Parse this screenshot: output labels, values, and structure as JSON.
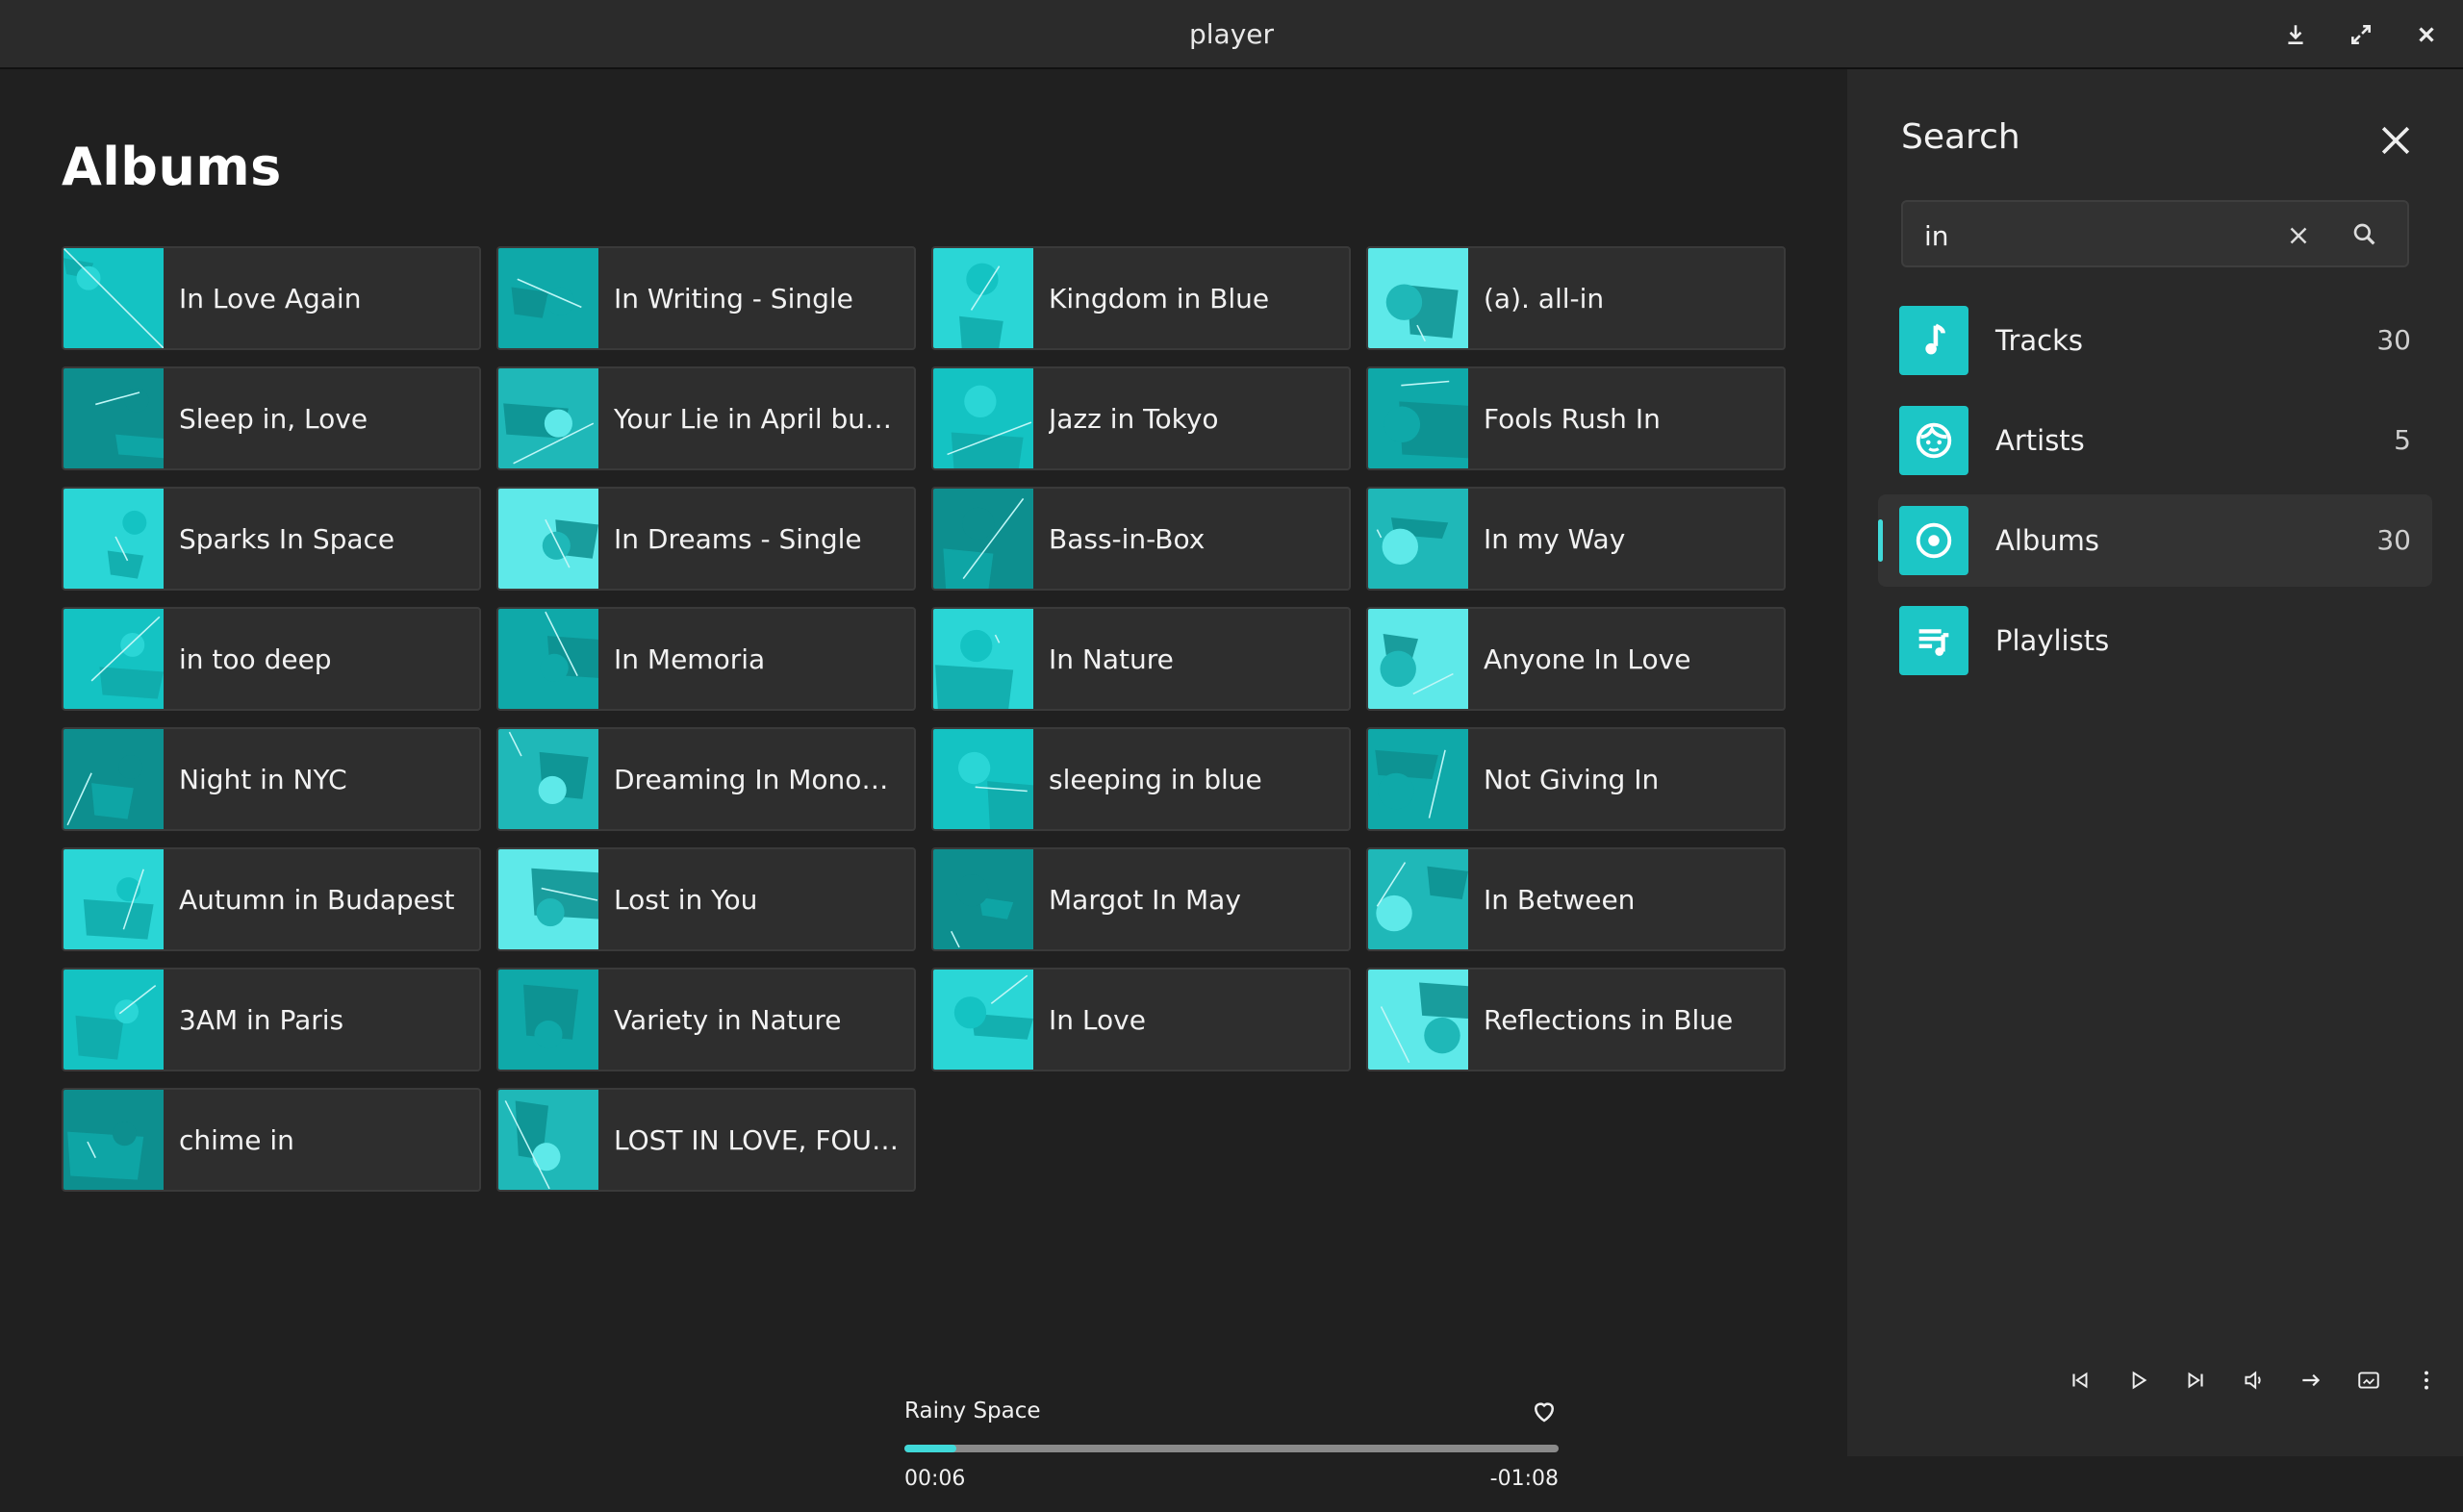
{
  "window": {
    "title": "player",
    "buttons": [
      "download-icon",
      "fullscreen-icon",
      "close-icon"
    ]
  },
  "main": {
    "heading": "Albums",
    "albums": [
      {
        "title": "In Love Again",
        "variant": 0
      },
      {
        "title": "In Writing - Single",
        "variant": 1
      },
      {
        "title": "Kingdom in Blue",
        "variant": 2
      },
      {
        "title": "(a). all-in",
        "variant": 3
      },
      {
        "title": "Sleep in, Love",
        "variant": 4
      },
      {
        "title": "Your Lie in April but in Lo-Fi",
        "variant": 5
      },
      {
        "title": "Jazz in Tokyo",
        "variant": 6
      },
      {
        "title": "Fools Rush In",
        "variant": 7
      },
      {
        "title": "Sparks In Space",
        "variant": 8
      },
      {
        "title": "In Dreams - Single",
        "variant": 9
      },
      {
        "title": "Bass-in-Box",
        "variant": 10
      },
      {
        "title": "In my Way",
        "variant": 11
      },
      {
        "title": "in too deep",
        "variant": 12
      },
      {
        "title": "In Memoria",
        "variant": 13
      },
      {
        "title": "In Nature",
        "variant": 14
      },
      {
        "title": "Anyone In Love",
        "variant": 15
      },
      {
        "title": "Night in NYC",
        "variant": 16
      },
      {
        "title": "Dreaming In Monochrome",
        "variant": 17
      },
      {
        "title": "sleeping in blue",
        "variant": 18
      },
      {
        "title": "Not Giving In",
        "variant": 19
      },
      {
        "title": "Autumn in Budapest",
        "variant": 20
      },
      {
        "title": "Lost in You",
        "variant": 21
      },
      {
        "title": "Margot In May",
        "variant": 22
      },
      {
        "title": "In Between",
        "variant": 23
      },
      {
        "title": "3AM in Paris",
        "variant": 24
      },
      {
        "title": "Variety in Nature",
        "variant": 25
      },
      {
        "title": "In Love",
        "variant": 26
      },
      {
        "title": "Reflections in Blue",
        "variant": 27
      },
      {
        "title": "chime in",
        "variant": 28
      },
      {
        "title": "LOST IN LOVE, FOUND IN YOU",
        "variant": 29
      }
    ]
  },
  "now_playing": {
    "title": "Rainy Space",
    "elapsed": "00:06",
    "remaining": "-01:08",
    "progress": 0.08,
    "favorite_icon": "heart-icon"
  },
  "sidebar": {
    "title": "Search",
    "search": {
      "value": "in",
      "placeholder": ""
    },
    "categories": [
      {
        "label": "Tracks",
        "count": "30",
        "icon": "music-note-icon",
        "selected": false
      },
      {
        "label": "Artists",
        "count": "5",
        "icon": "artist-face-icon",
        "selected": false
      },
      {
        "label": "Albums",
        "count": "30",
        "icon": "album-disc-icon",
        "selected": true
      },
      {
        "label": "Playlists",
        "count": "",
        "icon": "playlist-icon",
        "selected": false
      }
    ]
  },
  "controls": [
    "skip-previous-icon",
    "play-icon",
    "skip-next-icon",
    "volume-icon",
    "repeat-icon",
    "miniplayer-icon",
    "more-icon"
  ],
  "colors": {
    "accent": "#40d9d9",
    "icon_bg": "#1cc6c6",
    "background": "#202020",
    "sidebar": "#292929",
    "card": "#2e2e2e"
  }
}
